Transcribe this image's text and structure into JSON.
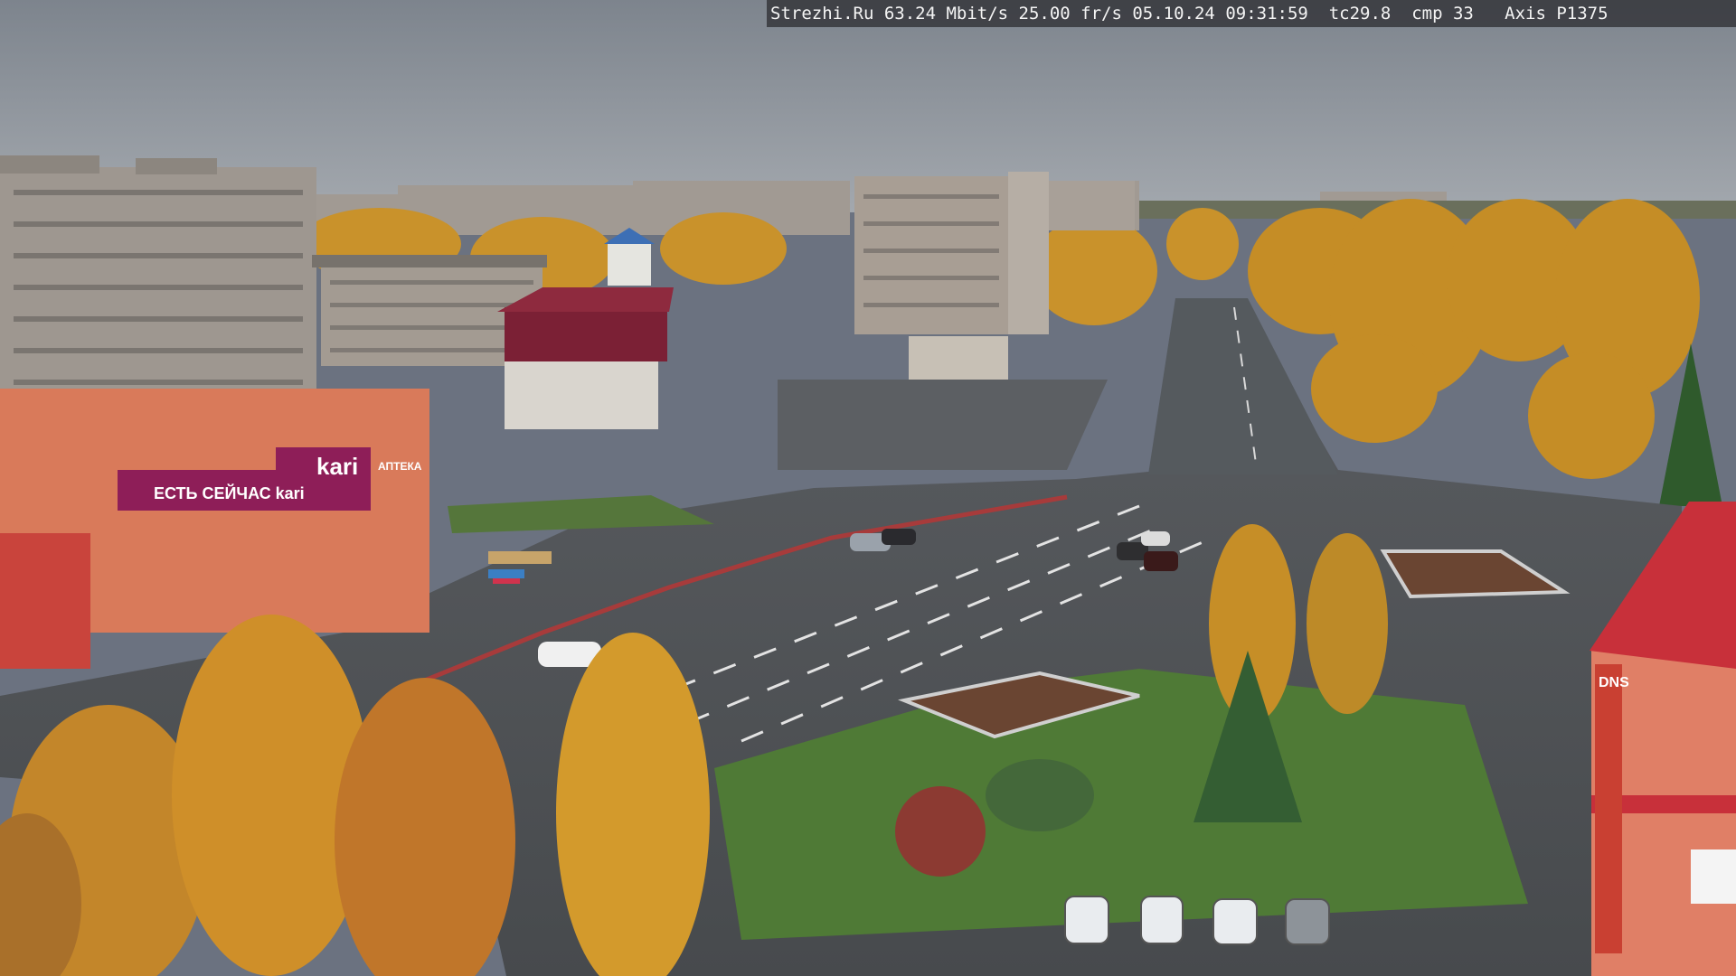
{
  "overlay": {
    "text": "Strezhi.Ru 63.24 Mbit/s 25.00 fr/s 05.10.24 09:31:59  tc29.8  cmp 33   Axis P1375"
  },
  "signs": {
    "store_main": "kari",
    "store_banner": "ЕСТЬ СЕЙЧАС kari",
    "pharmacy": "АПТЕКА",
    "dns": "DNS"
  },
  "colors": {
    "sky": "#8b929b",
    "autumn_foliage": "#d29a2a",
    "asphalt": "#4d5053",
    "grass": "#4f7a36",
    "brick_red": "#c0392b",
    "store_magenta": "#8e1e58"
  }
}
